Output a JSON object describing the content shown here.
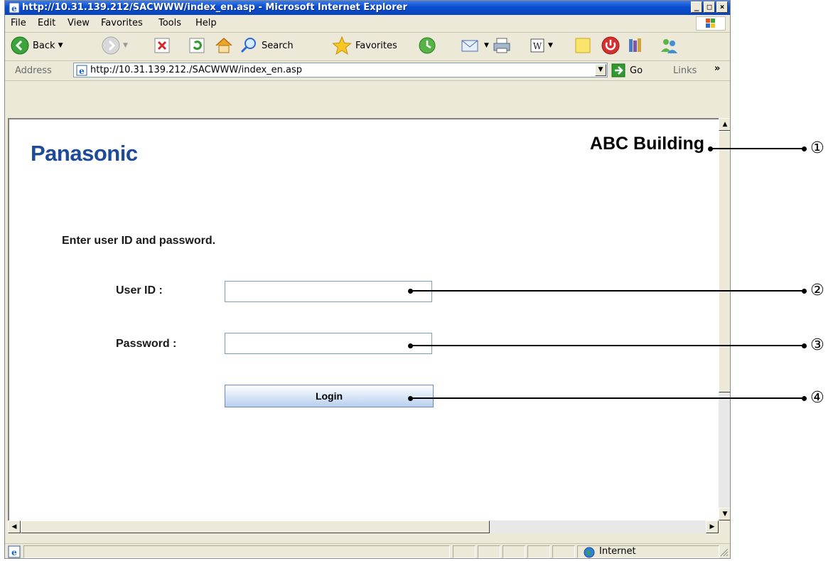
{
  "window": {
    "title": "http://10.31.139.212/SACWWW/index_en.asp - Microsoft Internet Explorer",
    "controls": [
      "_",
      "□",
      "×"
    ]
  },
  "menu": [
    "File",
    "Edit",
    "View",
    "Favorites",
    "Tools",
    "Help"
  ],
  "toolbar": {
    "back_label": "Back",
    "search_label": "Search",
    "favorites_label": "Favorites"
  },
  "address": {
    "label": "Address",
    "url": "http://10.31.139.212./SACWWW/index_en.asp",
    "go_label": "Go",
    "links_label": "Links",
    "more": "»"
  },
  "page": {
    "logo": "Panasonic",
    "building_name": "ABC Building",
    "prompt": "Enter user ID and password.",
    "user_id_label": "User ID :",
    "password_label": "Password :",
    "user_id_value": "",
    "password_value": "",
    "login_label": "Login"
  },
  "status": {
    "zone": "Internet"
  },
  "callouts": [
    "①",
    "②",
    "③",
    "④"
  ]
}
